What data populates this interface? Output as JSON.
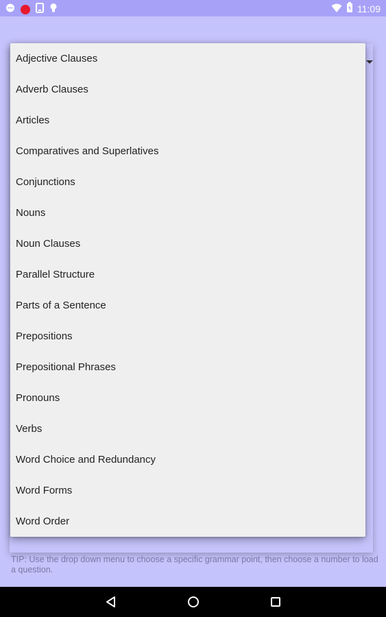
{
  "status_bar": {
    "time": "11:09",
    "left_icons": [
      "message-icon",
      "record-icon",
      "phone-icon",
      "lightbulb-icon"
    ],
    "right_icons": [
      "wifi-icon",
      "battery-icon"
    ]
  },
  "dropdown": {
    "items": [
      "Adjective Clauses",
      "Adverb Clauses",
      "Articles",
      "Comparatives and Superlatives",
      "Conjunctions",
      "Nouns",
      "Noun Clauses",
      "Parallel Structure",
      "Parts of a Sentence",
      "Prepositions",
      "Prepositional Phrases",
      "Pronouns",
      "Verbs",
      "Word Choice and Redundancy",
      "Word Forms",
      "Word Order"
    ]
  },
  "tip": "TIP: Use the drop down menu to choose a specific grammar point, then choose a number to load a question.",
  "colors": {
    "status_bar": "#a7a2f8",
    "background": "#c5c3fb",
    "dropdown_bg": "#efefef",
    "tip_text": "#7a79a8",
    "nav_bar": "#000000"
  }
}
